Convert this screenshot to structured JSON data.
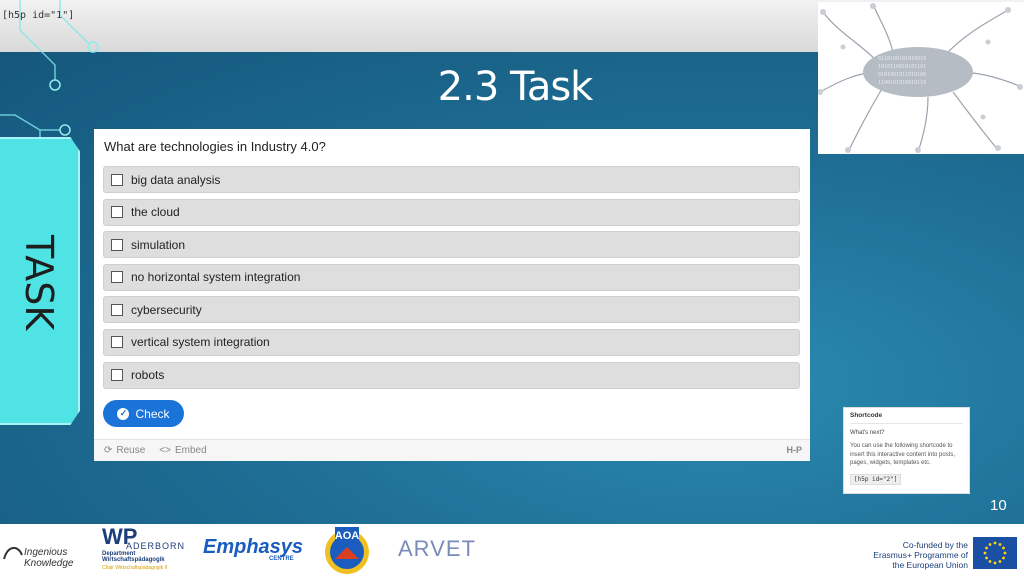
{
  "slide": {
    "shortcode_top": "[h5p id=\"1\"]",
    "title": "2.3 Task",
    "side_tab": "TASK",
    "page_number": "10"
  },
  "h5p": {
    "question": "What are technologies in Industry 4.0?",
    "answers": [
      "big data analysis",
      "the cloud",
      "simulation",
      "no horizontal system integration",
      "cybersecurity",
      "vertical system integration",
      "robots"
    ],
    "check_label": "Check",
    "footer": {
      "reuse": "Reuse",
      "embed": "Embed",
      "embed_icon": "<>",
      "logo": "H-P"
    }
  },
  "shortcode_panel": {
    "title": "Shortcode",
    "subtitle": "What's next?",
    "body": "You can use the following shortcode to insert this interactive content into posts, pages, widgets, templates etc.",
    "code": "[h5p id=\"2\"]"
  },
  "footer_logos": {
    "ik": "Ingenious Knowledge",
    "wp_big": "WP",
    "wp_sub": "ADERBORN",
    "wp_dept": "Department Wirtschaftspädagogik",
    "wp_foot": "Chair Wirtschaftspädagogik II",
    "emphasys": "Emphasys",
    "emphasys_sub": "CENTRE",
    "aoa": "AOA",
    "arvet": "ARVET",
    "eu": "Co-funded by the Erasmus+ Programme of the European Union"
  },
  "icons": {
    "checkbox": "checkbox-empty-icon",
    "check": "checkmark-circle-icon",
    "reuse": "reuse-icon",
    "embed": "embed-code-icon",
    "eu_flag": "eu-flag-icon"
  },
  "colors": {
    "background": "#1f6f96",
    "tab": "#4fe3e6",
    "check_button": "#1a73d9",
    "answer_bg": "#dedede"
  }
}
